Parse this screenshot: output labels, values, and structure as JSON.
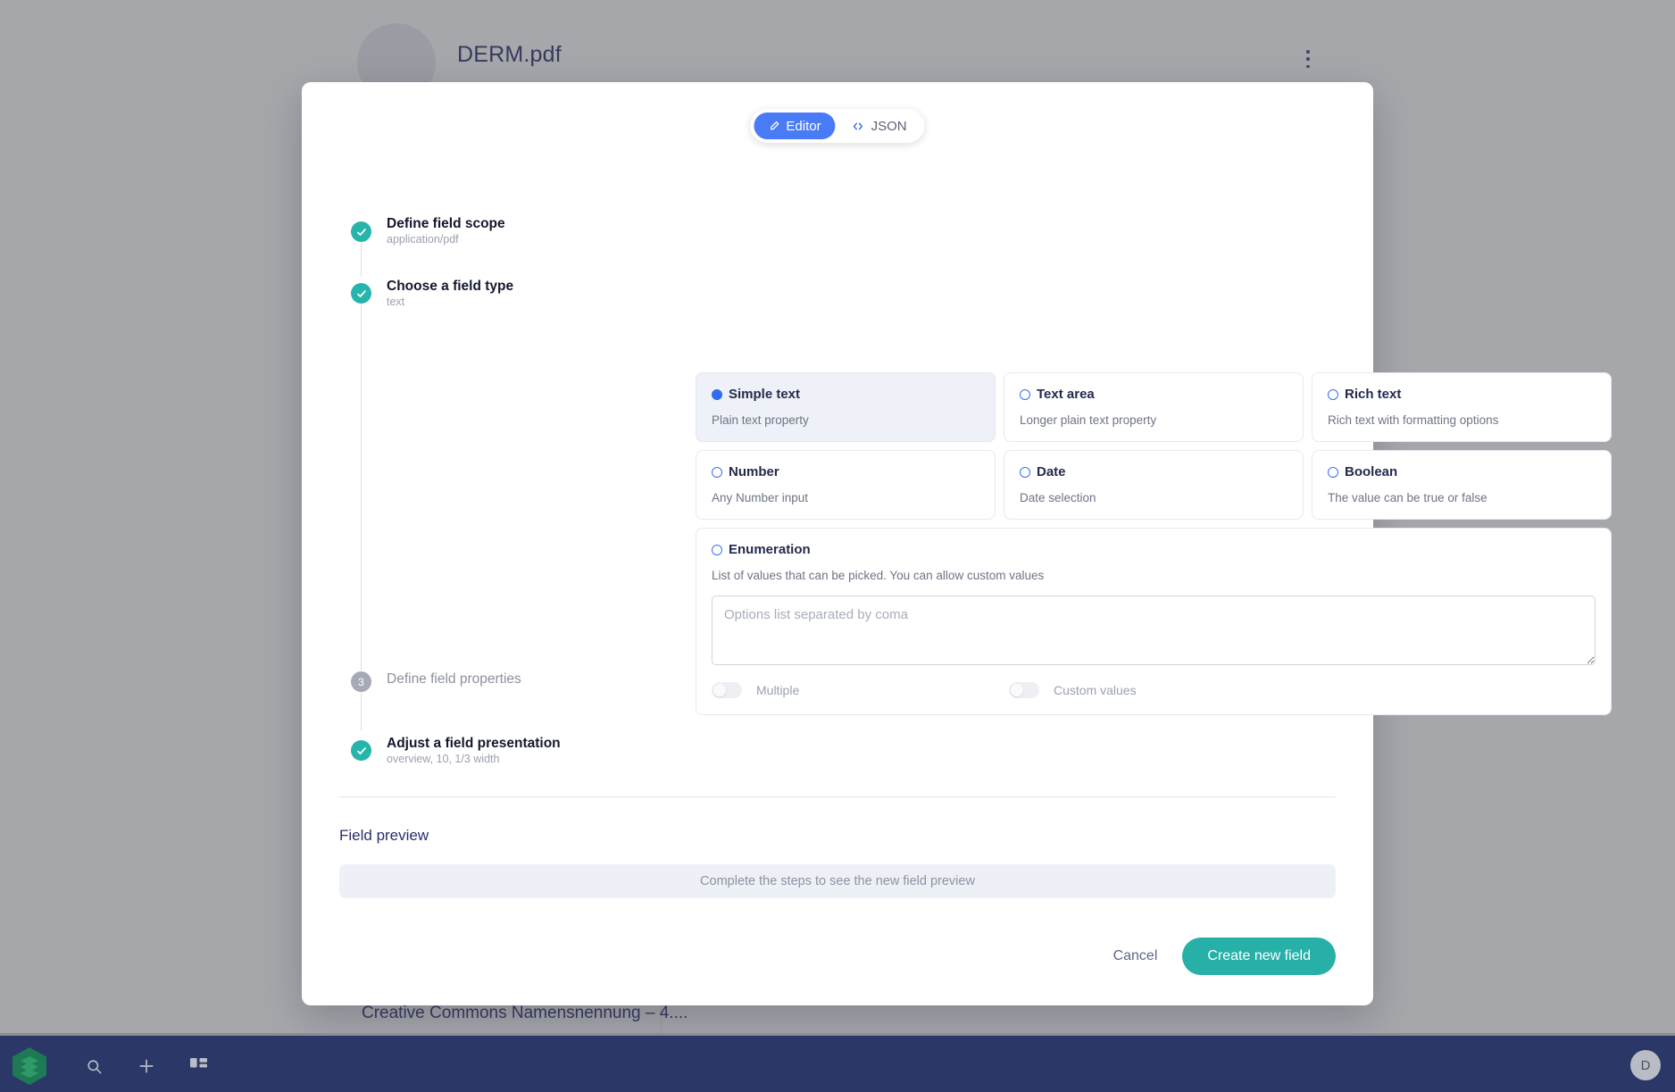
{
  "background": {
    "document_title": "DERM.pdf",
    "kebab_icon": "vertical-dots-icon",
    "license_text": "Creative Commons Namensnennung – 4...."
  },
  "modal": {
    "view_toggle": {
      "editor_label": "Editor",
      "editor_icon": "pencil-icon",
      "json_label": "JSON",
      "json_icon": "code-brackets-icon",
      "active": "Editor",
      "active_color": "#4a7bf7"
    },
    "steps": [
      {
        "number": "1",
        "title": "Define field scope",
        "subtitle": "application/pdf",
        "state": "done",
        "marker_icon": "check-icon",
        "marker_color": "#27b5ab"
      },
      {
        "number": "2",
        "title": "Choose a field type",
        "subtitle": "text",
        "state": "done",
        "marker_icon": "check-icon",
        "marker_color": "#27b5ab"
      },
      {
        "number": "3",
        "title": "Define field properties",
        "subtitle": "",
        "state": "idle",
        "marker_icon": "number-badge",
        "marker_color": "#a6aab5"
      },
      {
        "number": "4",
        "title": "Adjust a field presentation",
        "subtitle": "overview, 10, 1/3 width",
        "state": "done",
        "marker_icon": "check-icon",
        "marker_color": "#27b5ab"
      }
    ],
    "field_types": [
      {
        "name": "Simple text",
        "description": "Plain text property",
        "selected": true
      },
      {
        "name": "Text area",
        "description": "Longer plain text property",
        "selected": false
      },
      {
        "name": "Rich text",
        "description": "Rich text with formatting options",
        "selected": false
      },
      {
        "name": "Number",
        "description": "Any Number input",
        "selected": false
      },
      {
        "name": "Date",
        "description": "Date selection",
        "selected": false
      },
      {
        "name": "Boolean",
        "description": "The value can be true or false",
        "selected": false
      }
    ],
    "enumeration": {
      "name": "Enumeration",
      "description": "List of values that can be picked. You can allow custom values",
      "selected": false,
      "options_value": "",
      "options_placeholder": "Options list separated by coma",
      "toggles": [
        {
          "label": "Multiple",
          "on": false
        },
        {
          "label": "Custom values",
          "on": false
        }
      ]
    },
    "preview": {
      "title": "Field preview",
      "placeholder": "Complete the steps to see the new field preview"
    },
    "actions": {
      "cancel_label": "Cancel",
      "create_label": "Create new field",
      "create_color": "#26b0a8"
    }
  },
  "taskbar": {
    "logo_icon": "hexagon-stack-logo",
    "logo_color": "#1d7a54",
    "search_icon": "search-icon",
    "add_icon": "plus-icon",
    "apps_icon": "grid-apps-icon",
    "avatar_initial": "D",
    "background_color": "#2a3767"
  }
}
